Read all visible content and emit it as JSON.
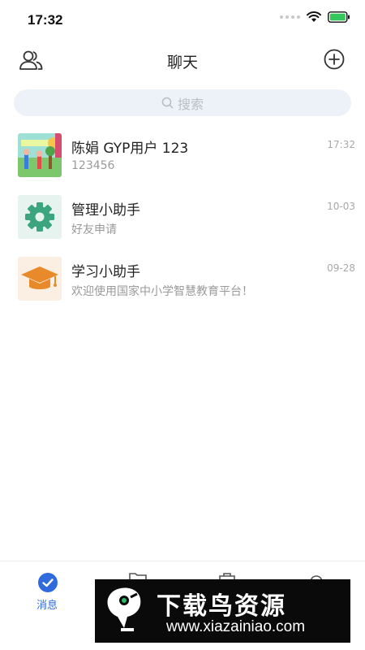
{
  "status_bar": {
    "time": "17:32"
  },
  "nav": {
    "title": "聊天"
  },
  "search": {
    "placeholder": "搜索"
  },
  "chats": [
    {
      "name": "陈娟 GYP用户 123",
      "preview": "123456",
      "time": "17:32",
      "avatar_icon": "image-thumbnail"
    },
    {
      "name": "管理小助手",
      "preview": "好友申请",
      "time": "10-03",
      "avatar_icon": "gear-icon",
      "avatar_color": "#3aa57f"
    },
    {
      "name": "学习小助手",
      "preview": "欢迎使用国家中小学智慧教育平台！",
      "time": "09-28",
      "avatar_icon": "graduation-cap-icon",
      "avatar_color": "#e88a2a"
    }
  ],
  "tabbar": {
    "active_label": "消息",
    "accent": "#2f6bdc"
  },
  "watermark": {
    "title": "下载鸟资源",
    "url": "www.xiazainiao.com"
  }
}
